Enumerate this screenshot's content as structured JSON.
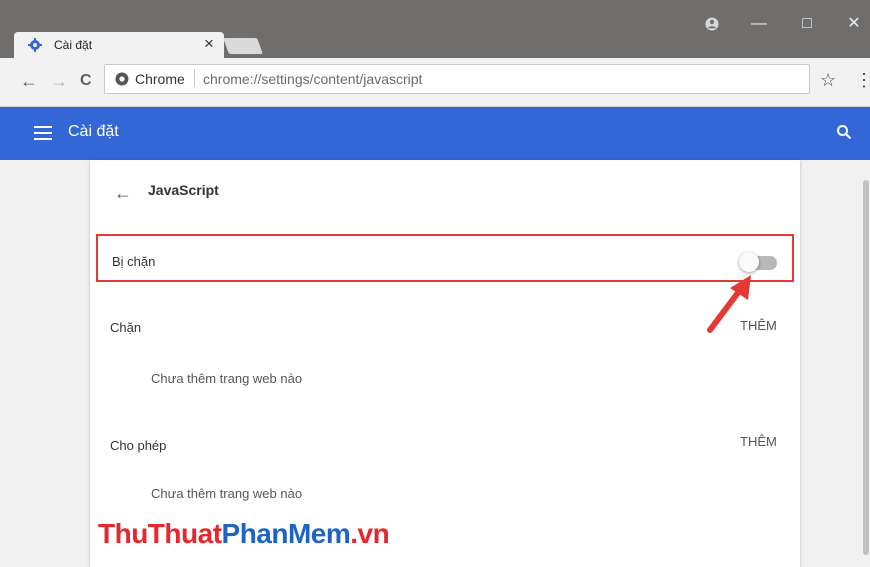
{
  "browser": {
    "tab": {
      "title": "Cài đặt",
      "close": "×"
    },
    "window_controls": {
      "account": "●",
      "minimize": "—",
      "maximize": "□",
      "close": "✕"
    },
    "nav": {
      "back": "←",
      "forward": "→",
      "reload": "C"
    },
    "omnibox": {
      "site_label": "Chrome",
      "url": "chrome://settings/content/javascript",
      "star": "☆",
      "menu": "⋮"
    }
  },
  "app_bar": {
    "title": "Cài đặt",
    "menu_icon": "☰",
    "search_icon": "🔍"
  },
  "page": {
    "back": "←",
    "title": "JavaScript",
    "toggle_row": {
      "label": "Bị chặn",
      "state": "off"
    },
    "sections": [
      {
        "label": "Chặn",
        "add_label": "THÊM",
        "empty_text": "Chưa thêm trang web nào"
      },
      {
        "label": "Cho phép",
        "add_label": "THÊM",
        "empty_text": "Chưa thêm trang web nào"
      }
    ]
  },
  "watermark": {
    "part1": "ThuThuat",
    "part2": "PhanMem",
    "part3": ".vn"
  },
  "colors": {
    "accent": "#3367d6",
    "highlight": "#e53935",
    "titlebar": "#6f6e6d"
  }
}
